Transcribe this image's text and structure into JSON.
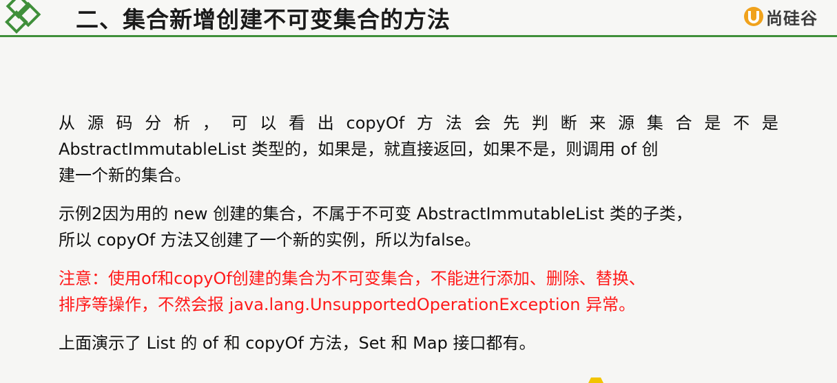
{
  "header": {
    "title": "二、集合新增创建不可变集合的方法",
    "brand_text": "尚硅谷",
    "accent_color": "#3f8f3a",
    "brand_color": "#f0a21c",
    "logo_icon": "diamond-logo-icon",
    "brand_icon": "u-shield-icon"
  },
  "content": {
    "p1": {
      "line1_chars": [
        "从",
        "源",
        "码",
        "分",
        "析",
        "，",
        "可",
        "以",
        "看",
        "出",
        "copyOf",
        "方",
        "法",
        "会",
        "先",
        "判",
        "断",
        "来",
        "源",
        "集",
        "合",
        "是",
        "不",
        "是"
      ],
      "line2": "AbstractImmutableList 类型的，如果是，就直接返回，如果不是，则调用 of 创",
      "line3": "建一个新的集合。"
    },
    "p2": {
      "line1": "示例2因为用的 new 创建的集合，不属于不可变 AbstractImmutableList 类的子类，",
      "line2": "所以 copyOf 方法又创建了一个新的实例，所以为false。"
    },
    "p3": {
      "line1": "注意：使用of和copyOf创建的集合为不可变集合，不能进行添加、删除、替换、",
      "line2": "排序等操作，不然会报 java.lang.UnsupportedOperationException 异常。",
      "color": "#ff1a1a"
    },
    "p4": {
      "line1": "上面演示了 List 的 of 和 copyOf 方法，Set 和 Map 接口都有。"
    }
  }
}
